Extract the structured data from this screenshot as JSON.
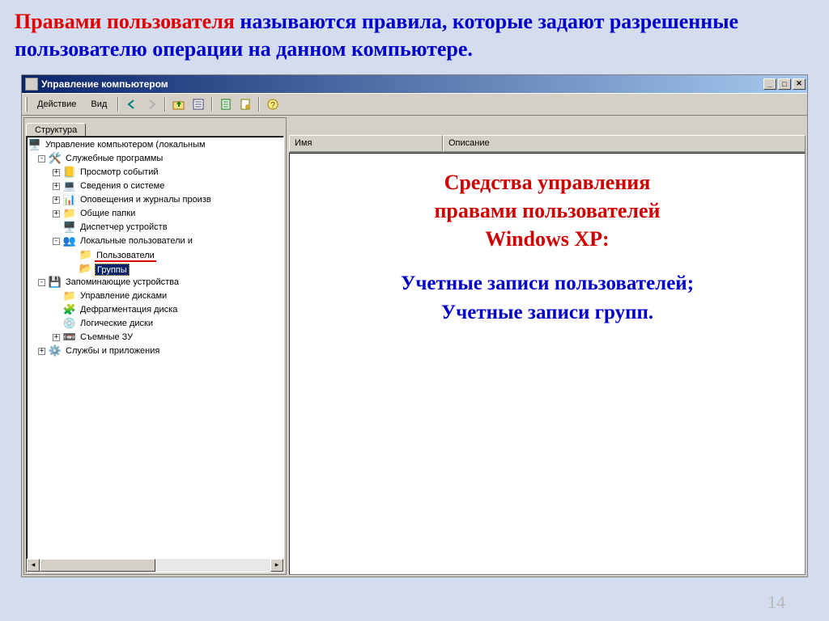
{
  "heading": {
    "part_red": "Правами пользователя",
    "part_blue_1": " называются правила, которые задают разрешенные пользователю операции на данном компьютере."
  },
  "window": {
    "title": "Управление компьютером",
    "toolbar": {
      "menu_action": "Действие",
      "menu_view": "Вид"
    },
    "left": {
      "tab": "Структура",
      "tree": {
        "root": "Управление компьютером (локальным",
        "system_tools": "Служебные программы",
        "event_viewer": "Просмотр событий",
        "system_info": "Сведения о системе",
        "alerts": "Оповещения и журналы произв",
        "shared_folders": "Общие папки",
        "device_manager": "Диспетчер устройств",
        "local_users": "Локальные пользователи и",
        "users": "Пользователи",
        "groups": "Группы",
        "storage": "Запоминающие устройства",
        "disk_mgmt": "Управление дисками",
        "defrag": "Дефрагментация диска",
        "logical_disks": "Логические диски",
        "removable": "Съемные ЗУ",
        "services": "Службы и приложения"
      }
    },
    "right": {
      "col_name": "Имя",
      "col_desc": "Описание",
      "overlay": {
        "title_l1": "Средства управления",
        "title_l2": "правами пользователей",
        "title_l3": "Windows XP:",
        "line1": "Учетные записи пользователей;",
        "line2": "Учетные записи групп."
      }
    }
  },
  "page_number": "14"
}
